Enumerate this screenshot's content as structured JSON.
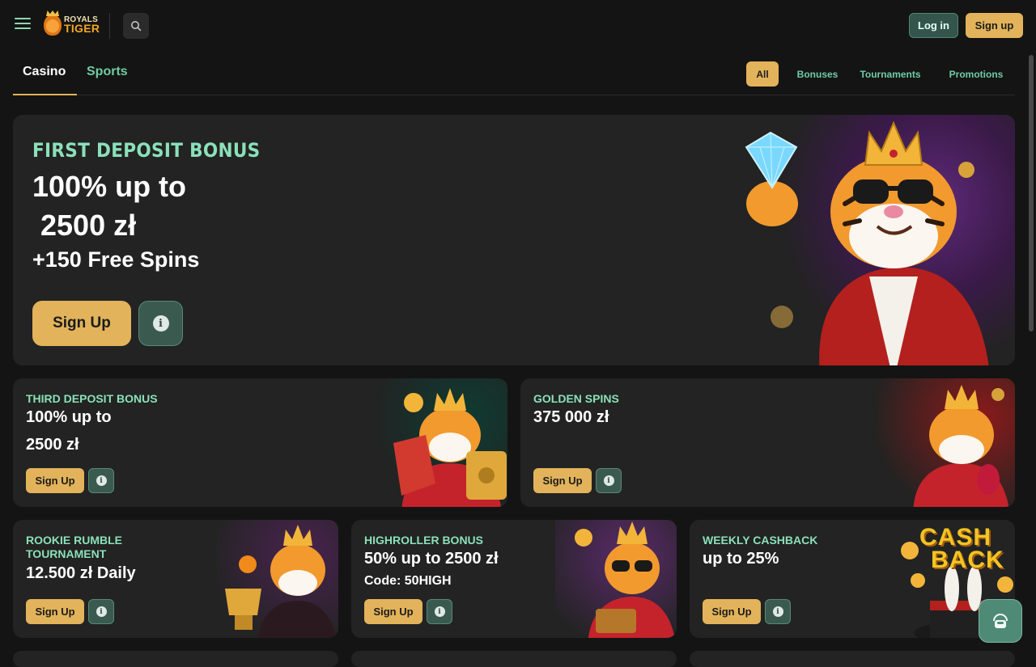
{
  "brand": {
    "line1": "ROYALS",
    "line2": "TIGER"
  },
  "header": {
    "login_label": "Log in",
    "signup_label": "Sign up"
  },
  "tabs": [
    {
      "label": "Casino"
    },
    {
      "label": "Sports"
    }
  ],
  "filters": [
    {
      "label": "All"
    },
    {
      "label": "Bonuses"
    },
    {
      "label": "Tournaments"
    },
    {
      "label": "Promotions"
    }
  ],
  "hero": {
    "title": "FIRST DEPOSIT BONUS",
    "line1": "100% up to",
    "line2": " 2500 zł",
    "line3": "+150 Free Spins",
    "cta": "Sign Up"
  },
  "cards": [
    {
      "title": "THIRD DEPOSIT BONUS",
      "line1": "100% up to",
      "line2": "2500 zł",
      "cta": "Sign Up"
    },
    {
      "title": "GOLDEN SPINS",
      "line1": "375 000 zł",
      "cta": "Sign Up"
    },
    {
      "title_line1": "ROOKIE RUMBLE",
      "title_line2": "TOURNAMENT",
      "line1": "12.500 zł Daily",
      "cta": "Sign Up"
    },
    {
      "title": "HIGHROLLER BONUS",
      "line1": "50% up to 2500 zł",
      "line2": "Code: 50HIGH",
      "cta": "Sign Up"
    },
    {
      "title": "WEEKLY CASHBACK",
      "line1": "up to 25%",
      "cta": "Sign Up",
      "art_line1": "CASH",
      "art_line2": "BACK"
    }
  ],
  "colors": {
    "accent": "#e2b35a",
    "mint": "#8be0b9",
    "bg": "#141414",
    "card": "#222322"
  }
}
